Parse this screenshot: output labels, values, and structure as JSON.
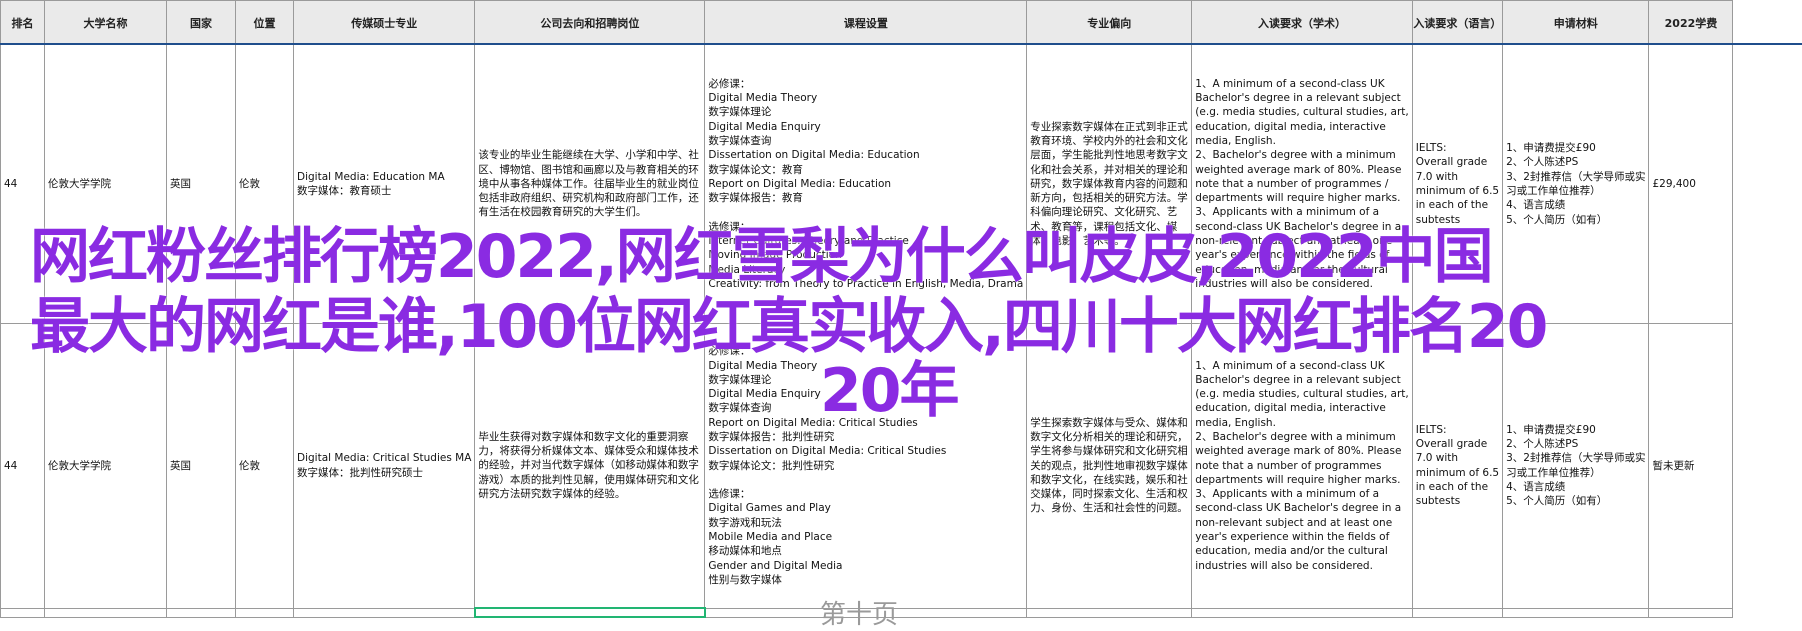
{
  "headers": [
    "排名",
    "大学名称",
    "国家",
    "位置",
    "传媒硕士专业",
    "公司去向和招聘岗位",
    "课程设置",
    "专业偏向",
    "入读要求（学术）",
    "入读要求（语言）",
    "申请材料",
    "2022学费"
  ],
  "rows": [
    {
      "rank": "44",
      "university": "伦敦大学学院",
      "country": "英国",
      "location": "伦敦",
      "program": [
        "Digital Media: Education MA",
        "数字媒体：教育硕士"
      ],
      "career": "该专业的毕业生能继续在大学、小学和中学、社区、博物馆、图书馆和画廊以及与教育相关的环境中从事各种媒体工作。往届毕业生的就业岗位包括非政府组织、研究机构和政府部门工作，还有生活在校园教育研究的大学生们。",
      "courses": [
        "必修课：",
        "Digital Media Theory",
        "数字媒体理论",
        "Digital Media Enquiry",
        "数字媒体查询",
        "Dissertation on Digital Media: Education",
        "数字媒体论文：教育",
        "Report on Digital Media: Education",
        "数字媒体报告：教育",
        "",
        "选修课：",
        "Internet Cultures: Theory and Practice",
        "Moving Image Production",
        "Media Literacy",
        "Creativity: from Theory to Practice in English, Media, Drama"
      ],
      "focus": "专业探索数字媒体在正式到非正式教育环境、学校内外的社会和文化层面，学生能批判性地思考数字文化和社会关系，并对相关的理论和研究，数字媒体教育内容的问题和新方向，包括相关的研究方法。学科偏向理论研究、文化研究、艺术、教育等，课程包括文化、媒体、电影、艺术等。",
      "academic": [
        "1、A minimum of a second-class UK",
        "Bachelor's degree in a relevant subject",
        "(e.g. media studies, cultural studies, art,",
        "education, digital media, interactive",
        "media, English.",
        "2、Bachelor's degree with a minimum",
        "weighted average mark of 80%. Please",
        "note that a number of programmes /",
        "departments will require higher marks.",
        "3、Applicants with a minimum of a",
        "second-class UK Bachelor's degree in a",
        "non-relevant subject and at least one",
        "year's experience within the fields of",
        "education, media and/or the cultural",
        "industries will also be considered."
      ],
      "language": [
        "IELTS:",
        "Overall grade",
        "7.0 with",
        "minimum of 6.5",
        "in each of the",
        "subtests"
      ],
      "materials": [
        "1、申请费提交£90",
        "2、个人陈述PS",
        "3、2封推荐信（大学导师或实",
        "习或工作单位推荐）",
        "4、语言成绩",
        "5、个人简历（如有）"
      ],
      "fee": "£29,400"
    },
    {
      "rank": "44",
      "university": "伦敦大学学院",
      "country": "英国",
      "location": "伦敦",
      "program": [
        "Digital Media: Critical Studies MA",
        "数字媒体：批判性研究硕士"
      ],
      "career": "毕业生获得对数字媒体和数字文化的重要洞察力，将获得分析媒体文本、媒体受众和媒体技术的经验，并对当代数字媒体（如移动媒体和数字游戏）本质的批判性见解，使用媒体研究和文化研究方法研究数字媒体的经验。",
      "courses": [
        "必修课：",
        "Digital Media Theory",
        "数字媒体理论",
        "Digital Media Enquiry",
        "数字媒体查询",
        "Report on Digital Media: Critical Studies",
        "数字媒体报告：批判性研究",
        "Dissertation on Digital Media: Critical Studies",
        "数字媒体论文：批判性研究",
        "",
        "选修课：",
        "Digital Games and Play",
        "数字游戏和玩法",
        "Mobile Media and Place",
        "移动媒体和地点",
        "Gender and Digital Media",
        "性别与数字媒体"
      ],
      "focus": "学生探索数字媒体与受众、媒体和数字文化分析相关的理论和研究，学生将参与媒体研究和文化研究相关的观点，批判性地审视数字媒体和数字文化，在线实践，娱乐和社交媒体，同时探索文化、生活和权力、身份、生活和社会性的问题。",
      "academic": [
        "1、A minimum of a second-class UK",
        "Bachelor's degree in a relevant subject",
        "(e.g. media studies, cultural studies, art,",
        "education, digital media, interactive",
        "media, English.",
        "2、Bachelor's degree with a minimum",
        "weighted average mark of 80%. Please",
        "note that a number of programmes",
        "departments will require higher marks.",
        "3、Applicants with a minimum of a",
        "second-class UK Bachelor's degree in a",
        "non-relevant subject and at least one",
        "year's experience within the fields of",
        "education, media and/or the cultural",
        "industries will also be considered."
      ],
      "language": [
        "IELTS:",
        "Overall grade",
        "7.0 with",
        "minimum of 6.5",
        "in each of the",
        "subtests"
      ],
      "materials": [
        "1、申请费提交£90",
        "2、个人陈述PS",
        "3、2封推荐信（大学导师或实",
        "习或工作单位推荐）",
        "4、语言成绩",
        "5、个人简历（如有）"
      ],
      "fee": "暂未更新"
    }
  ],
  "overlay": {
    "line1": "网红粉丝排行榜2022,网红雪梨为什么叫皮皮,2022中国",
    "line2": "最大的网红是谁,100位网红真实收入,四川十大网红排名20",
    "line3": "20年"
  },
  "bottom_text": "第十页",
  "colors": {
    "overlay": "#8a2be2",
    "selection": "#22b573",
    "header_line": "#1f4e8c"
  }
}
